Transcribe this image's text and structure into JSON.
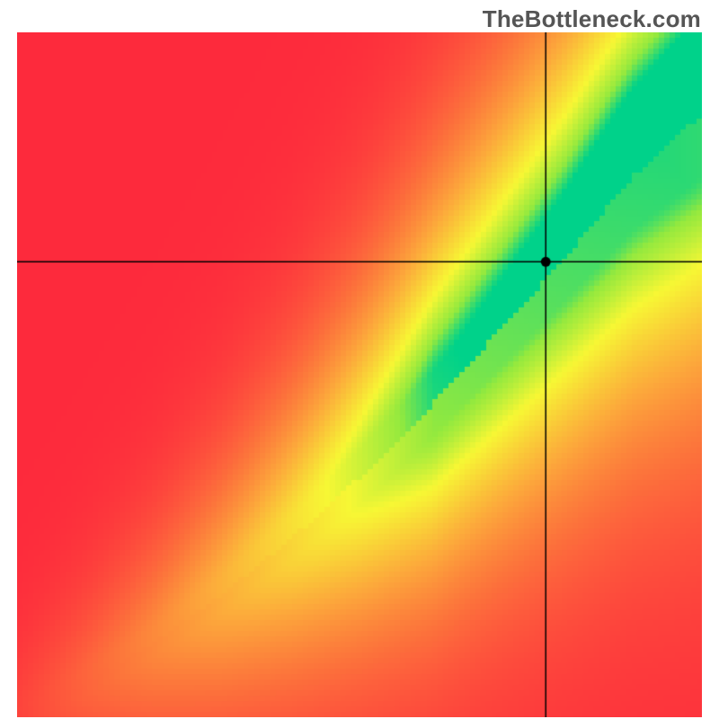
{
  "watermark": "TheBottleneck.com",
  "chart_data": {
    "type": "heatmap",
    "title": "",
    "xlabel": "",
    "ylabel": "",
    "xlim": [
      0,
      1
    ],
    "ylim": [
      0,
      1
    ],
    "grid": false,
    "legend": false,
    "marker": {
      "x": 0.772,
      "y": 0.665
    },
    "crosshair_lines": [
      {
        "orientation": "vertical",
        "x": 0.772
      },
      {
        "orientation": "horizontal",
        "y": 0.665
      }
    ],
    "optimal_curve": {
      "description": "Approximate centerline of green band (y as function of x)",
      "x": [
        0.0,
        0.1,
        0.2,
        0.3,
        0.4,
        0.5,
        0.6,
        0.7,
        0.8,
        0.9,
        1.0
      ],
      "y": [
        0.0,
        0.05,
        0.11,
        0.18,
        0.26,
        0.35,
        0.45,
        0.56,
        0.67,
        0.79,
        0.88
      ]
    },
    "band_halfwidth": {
      "description": "Approximate half-width of green band around centerline (in y units)",
      "x": [
        0.0,
        0.2,
        0.4,
        0.6,
        0.8,
        1.0
      ],
      "w": [
        0.01,
        0.018,
        0.03,
        0.045,
        0.06,
        0.09
      ]
    },
    "color_scale": {
      "stops": [
        {
          "t": 0.0,
          "color": "#fd2a3c"
        },
        {
          "t": 0.45,
          "color": "#fca93b"
        },
        {
          "t": 0.72,
          "color": "#f7f734"
        },
        {
          "t": 0.9,
          "color": "#94e93e"
        },
        {
          "t": 1.0,
          "color": "#00d28a"
        }
      ],
      "meaning": "0 = far from optimal (red), 1 = on optimal curve (green)"
    },
    "field": {
      "description": "Heat value at (x,y) estimated as closeness to optimal curve scaled by magnitude; values are illustrative samples read from image.",
      "samples": [
        {
          "x": 0.05,
          "y": 0.9,
          "v": 0.02
        },
        {
          "x": 0.1,
          "y": 0.1,
          "v": 0.55
        },
        {
          "x": 0.3,
          "y": 0.18,
          "v": 0.98
        },
        {
          "x": 0.5,
          "y": 0.35,
          "v": 1.0
        },
        {
          "x": 0.7,
          "y": 0.56,
          "v": 1.0
        },
        {
          "x": 0.9,
          "y": 0.79,
          "v": 1.0
        },
        {
          "x": 0.9,
          "y": 0.3,
          "v": 0.3
        },
        {
          "x": 0.3,
          "y": 0.7,
          "v": 0.18
        },
        {
          "x": 0.772,
          "y": 0.665,
          "v": 0.78
        },
        {
          "x": 0.95,
          "y": 0.05,
          "v": 0.08
        }
      ]
    }
  }
}
